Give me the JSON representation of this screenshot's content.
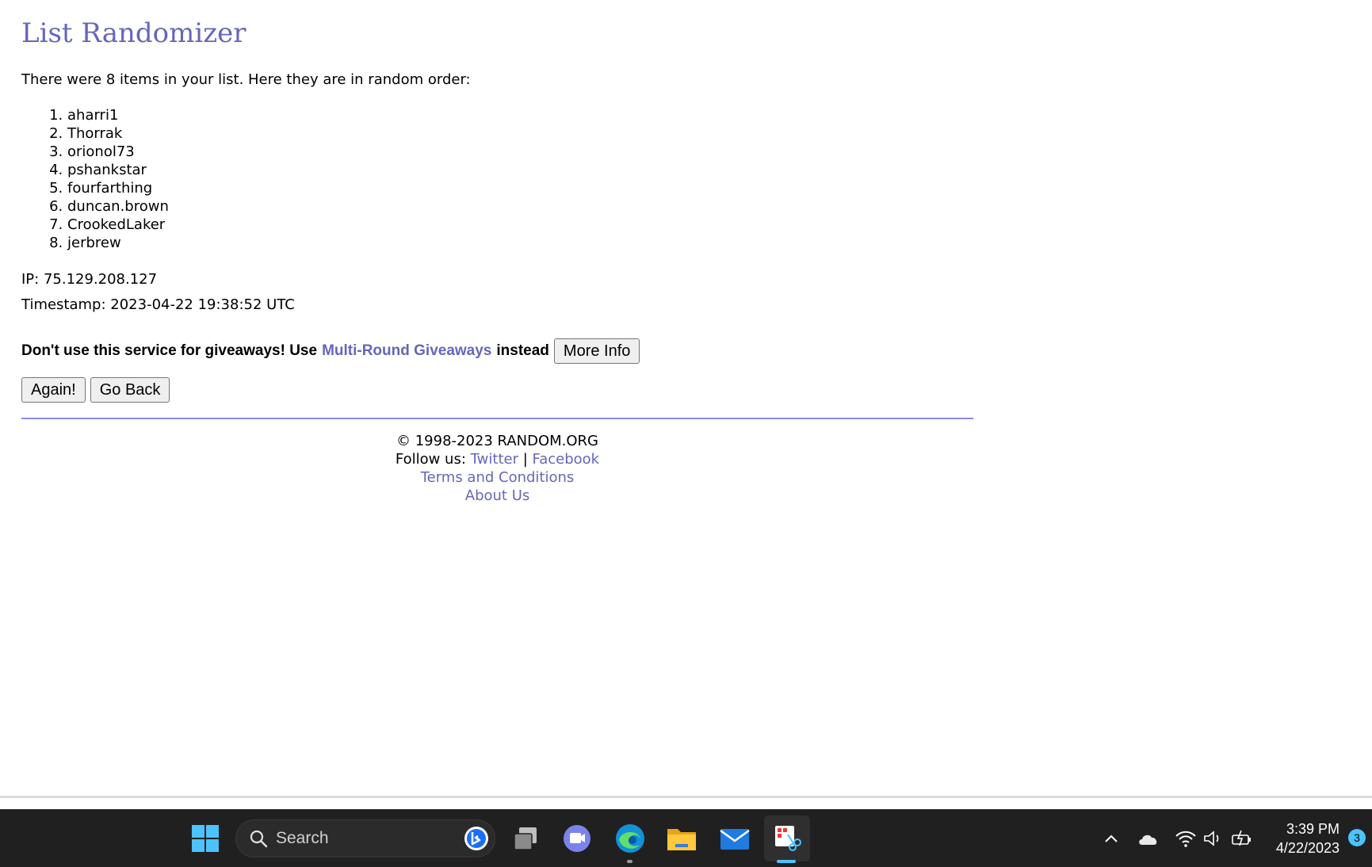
{
  "page": {
    "title": "List Randomizer",
    "intro": "There were 8 items in your list. Here they are in random order:",
    "items": [
      "aharri1",
      "Thorrak",
      "orionol73",
      "pshankstar",
      "fourfarthing",
      "duncan.brown",
      "CrookedLaker",
      "jerbrew"
    ],
    "ip": "IP: 75.129.208.127",
    "timestamp": "Timestamp: 2023-04-22 19:38:52 UTC",
    "notice": {
      "prefix": "Don't use this service for giveaways! Use",
      "link": "Multi-Round Giveaways",
      "suffix": "instead",
      "button": "More Info"
    },
    "buttons": {
      "again": "Again!",
      "back": "Go Back"
    },
    "footer": {
      "copyright": "© 1998-2023 RANDOM.ORG",
      "follow_label": "Follow us:",
      "twitter": "Twitter",
      "separator": "|",
      "facebook": "Facebook",
      "terms": "Terms and Conditions",
      "about": "About Us"
    }
  },
  "taskbar": {
    "search_placeholder": "Search",
    "time": "3:39 PM",
    "date": "4/22/2023",
    "notification_count": "3",
    "icons": [
      "windows-start-icon",
      "search-icon",
      "bing-icon",
      "task-view-icon",
      "teams-chat-icon",
      "edge-icon",
      "file-explorer-icon",
      "mail-icon",
      "snipping-tool-icon",
      "chevron-up-icon",
      "onedrive-icon",
      "wifi-icon",
      "volume-icon",
      "battery-icon"
    ]
  },
  "colors": {
    "accent": "#6666bb",
    "rule": "#8a8aee",
    "taskbar": "#202020"
  }
}
